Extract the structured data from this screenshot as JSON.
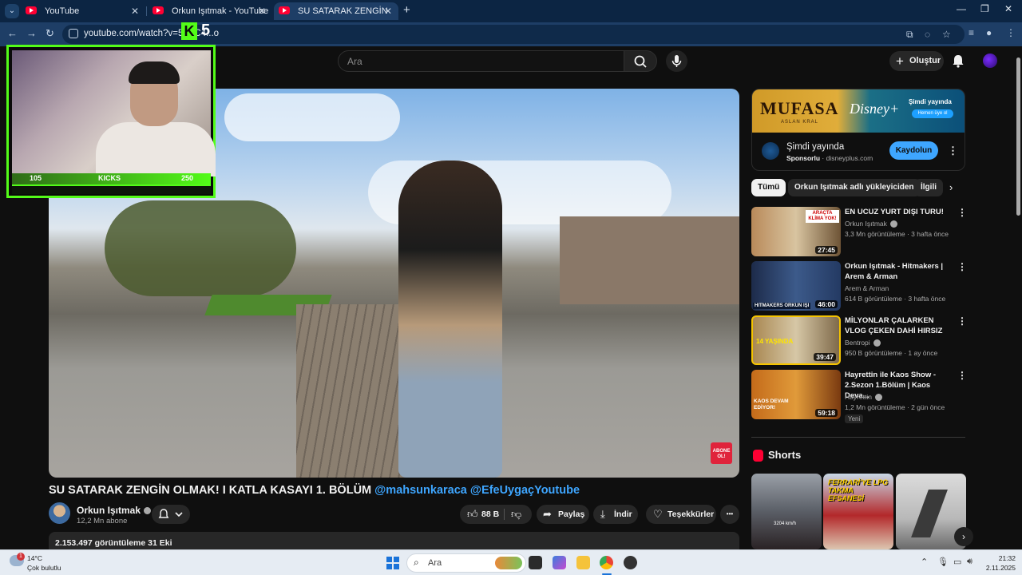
{
  "browser": {
    "tabs": [
      {
        "title": "YouTube",
        "active": false
      },
      {
        "title": "Orkun Işıtmak - YouTube",
        "active": false
      },
      {
        "title": "SU SATARAK ZENGİN OLMAK! I",
        "active": true
      }
    ],
    "new_tab": "+",
    "url": "youtube.com/watch?v=5HcC4...o",
    "window_controls": {
      "minimize": "—",
      "restore": "❐",
      "close": "✕"
    }
  },
  "stream_overlay": {
    "badge_number": "5",
    "stat_left": "105",
    "stat_label": "KICKS",
    "stat_right": "250",
    "accent": "#53fc18"
  },
  "youtube": {
    "search_placeholder": "Ara",
    "create_label": "Oluştur",
    "video": {
      "title": "SU SATARAK ZENGİN OLMAK! I KATLA KASAYI 1. BÖLÜM",
      "tags": "@mahsunkaraca @EfeUygaçYoutube",
      "subscribe_badge": "ABONE OL!",
      "channel_name": "Orkun Işıtmak",
      "subscribers": "12,2 Mn abone",
      "likes": "88 B",
      "share_label": "Paylaş",
      "download_label": "İndir",
      "thanks_label": "Teşekkürler",
      "more": "•••",
      "views_date": "2.153.497 görüntüleme  31 Eki"
    },
    "ad": {
      "banner_title": "MUFASA",
      "banner_subtitle": "ASLAN KRAL",
      "banner_brand": "Disney+",
      "banner_now": "Şimdi yayında",
      "banner_join": "Hemen üye ol",
      "title": "Şimdi yayında",
      "sponsor_label": "Sponsorlu",
      "domain": "· disneyplus.com",
      "button": "Kaydolun"
    },
    "chips": [
      "Tümü",
      "Orkun Işıtmak adlı yükleyiciden",
      "İlgili"
    ],
    "recommendations": [
      {
        "title": "EN UCUZ YURT DIŞI TURU!",
        "channel": "Orkun Işıtmak",
        "meta": "3,3 Mn görüntüleme · 3 hafta önce",
        "duration": "27:45",
        "thumb_text": "ARAÇTA KLİMA YOK!",
        "badge": ""
      },
      {
        "title": "Orkun Işıtmak - Hitmakers | Arem & Arman",
        "channel": "Arem & Arman",
        "meta": "614 B görüntüleme · 3 hafta önce",
        "duration": "46:00",
        "thumb_text": "HITMAKERS  ORKUN IŞI",
        "badge": ""
      },
      {
        "title": "MİLYONLAR ÇALARKEN VLOG ÇEKEN DAHİ HIRSIZ",
        "channel": "Bentropi",
        "meta": "950 B görüntüleme · 1 ay önce",
        "duration": "39:47",
        "thumb_text": "14 YAŞINDA",
        "badge": ""
      },
      {
        "title": "Hayrettin ile Kaos Show - 2.Sezon 1.Bölüm | Kaos Deva...",
        "channel": "Hayrettin",
        "meta": "1,2 Mn görüntüleme · 2 gün önce",
        "duration": "59:18",
        "thumb_text": "KAOS DEVAM EDİYOR!",
        "badge": "Yeni"
      }
    ],
    "shorts_title": "Shorts",
    "shorts": [
      {
        "text": "3204 km/h"
      },
      {
        "text": "FERRARİ'YE LPG TAKMA EFSANESİ"
      },
      {
        "text": ""
      }
    ]
  },
  "taskbar": {
    "weather_temp": "14°C",
    "weather_desc": "Çok bulutlu",
    "weather_badge": "1",
    "search_placeholder": "Ara",
    "time": "21:32",
    "date": "2.11.2025"
  }
}
